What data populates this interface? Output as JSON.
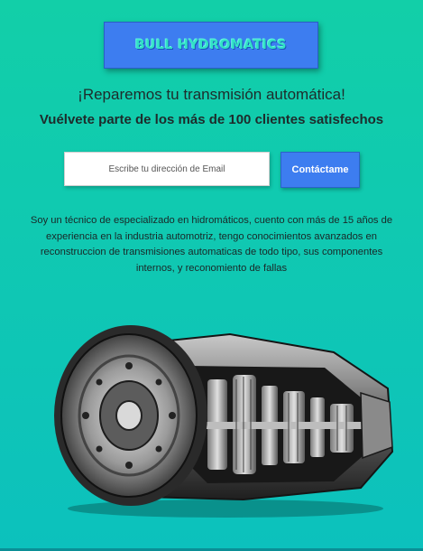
{
  "brand": {
    "title": "BULL HYDROMATICS"
  },
  "hero": {
    "headline": "¡Reparemos tu transmisión automática!",
    "subheadline": "Vuélvete parte de los más de 100 clientes satisfechos"
  },
  "signup": {
    "email_placeholder": "Escribe tu dirección de Email",
    "email_value": "",
    "contact_label": "Contáctame"
  },
  "about": {
    "text": "Soy un técnico de especializado en hidromáticos, cuento con más de 15 años de experiencia en la industria automotriz, tengo conocimientos avanzados en reconstruccion de transmisiones automaticas de todo tipo, sus componentes internos, y reconomiento de fallas"
  },
  "colors": {
    "background_top": "#12cfa8",
    "background_bottom": "#0cc1bd",
    "button_blue": "#3d7df0",
    "logo_text": "#32e2c6"
  },
  "image": {
    "icon": "transmission-cutaway-image"
  }
}
